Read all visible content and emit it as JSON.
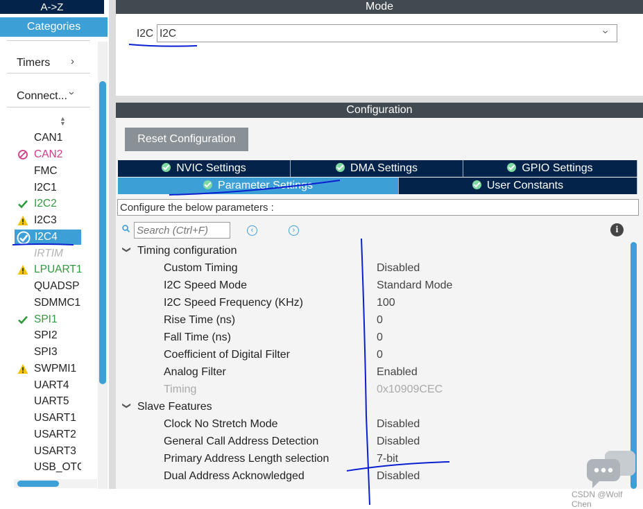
{
  "left_panel": {
    "sort_label": "A->Z",
    "categories_label": "Categories",
    "groups": [
      {
        "label": "Timers",
        "chevron": "chevron-right"
      },
      {
        "label": "Connect...",
        "chevron": "chevron-down"
      }
    ],
    "peripherals": [
      {
        "label": "CAN1",
        "status": "none"
      },
      {
        "label": "CAN2",
        "status": "blocked"
      },
      {
        "label": "FMC",
        "status": "none"
      },
      {
        "label": "I2C1",
        "status": "none"
      },
      {
        "label": "I2C2",
        "status": "ok"
      },
      {
        "label": "I2C3",
        "status": "warning"
      },
      {
        "label": "I2C4",
        "status": "selected"
      },
      {
        "label": "IRTIM",
        "status": "disabled"
      },
      {
        "label": "LPUART1",
        "status": "warning"
      },
      {
        "label": "QUADSP",
        "status": "none"
      },
      {
        "label": "SDMMC1",
        "status": "none"
      },
      {
        "label": "SPI1",
        "status": "ok"
      },
      {
        "label": "SPI2",
        "status": "none"
      },
      {
        "label": "SPI3",
        "status": "none"
      },
      {
        "label": "SWPMI1",
        "status": "warning"
      },
      {
        "label": "UART4",
        "status": "none"
      },
      {
        "label": "UART5",
        "status": "none"
      },
      {
        "label": "USART1",
        "status": "none"
      },
      {
        "label": "USART2",
        "status": "none"
      },
      {
        "label": "USART3",
        "status": "none"
      },
      {
        "label": "USB_OTG",
        "status": "none"
      }
    ]
  },
  "mode": {
    "header": "Mode",
    "label": "I2C",
    "selected": "I2C"
  },
  "configuration": {
    "header": "Configuration",
    "reset_label": "Reset Configuration",
    "tabs_row1": [
      "NVIC Settings",
      "DMA Settings",
      "GPIO Settings"
    ],
    "tabs_row2": [
      "Parameter Settings",
      "User Constants"
    ],
    "active_tab": "Parameter Settings",
    "hint": "Configure the below parameters :",
    "search_placeholder": "Search (Ctrl+F)",
    "sections": [
      {
        "title": "Timing configuration",
        "params": [
          {
            "name": "Custom Timing",
            "value": "Disabled",
            "dim": false
          },
          {
            "name": "I2C Speed Mode",
            "value": "Standard Mode",
            "dim": false
          },
          {
            "name": "I2C Speed Frequency (KHz)",
            "value": "100",
            "dim": false
          },
          {
            "name": "Rise Time (ns)",
            "value": "0",
            "dim": false
          },
          {
            "name": "Fall Time (ns)",
            "value": "0",
            "dim": false
          },
          {
            "name": "Coefficient of Digital Filter",
            "value": "0",
            "dim": false
          },
          {
            "name": "Analog Filter",
            "value": "Enabled",
            "dim": false
          },
          {
            "name": "Timing",
            "value": "0x10909CEC",
            "dim": true
          }
        ]
      },
      {
        "title": "Slave Features",
        "params": [
          {
            "name": "Clock No Stretch Mode",
            "value": "Disabled",
            "dim": false
          },
          {
            "name": "General Call Address Detection",
            "value": "Disabled",
            "dim": false
          },
          {
            "name": "Primary Address Length selection",
            "value": "7-bit",
            "dim": false
          },
          {
            "name": "Dual Address Acknowledged",
            "value": "Disabled",
            "dim": false
          }
        ]
      }
    ]
  },
  "watermark": "CSDN @Wolf Chen",
  "colors": {
    "navy": "#03234b",
    "accent": "#3c9fd6",
    "header_gray": "#414a51",
    "ok_green": "#2e9a3e",
    "blocked_pink": "#d23a86",
    "warning_yellow": "#f4c20d",
    "annotation_blue": "#0a1fd0"
  }
}
